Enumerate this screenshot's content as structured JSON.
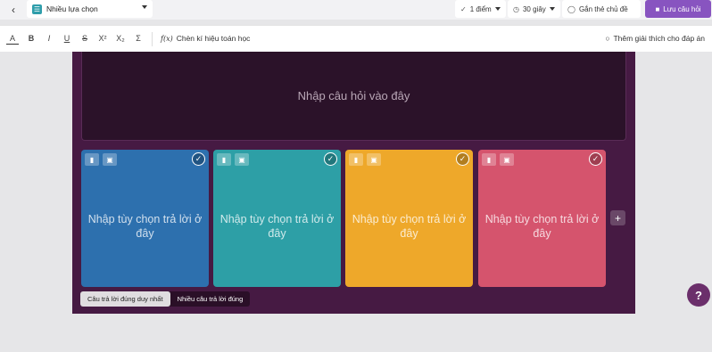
{
  "topbar": {
    "question_type": {
      "label": "Nhiều lựa chọn",
      "icon": "checklist-icon"
    },
    "points": {
      "label": "1 điểm",
      "icon": "check-icon"
    },
    "time": {
      "label": "30 giây",
      "icon": "clock-icon"
    },
    "tag": {
      "label": "Gắn thẻ chủ đề",
      "icon": "tag-icon"
    },
    "save": {
      "label": "Lưu câu hỏi",
      "icon": "save-icon"
    }
  },
  "format_toolbar": {
    "items": [
      "A",
      "B",
      "I",
      "U",
      "S",
      "X²",
      "X₂",
      "Σ"
    ],
    "math_label": "Chèn kí hiệu toán học",
    "math_icon_text": "f(x)",
    "explanation_label": "Thêm giải thích cho đáp án"
  },
  "question": {
    "placeholder": "Nhập câu hỏi vào đây"
  },
  "answers": [
    {
      "placeholder": "Nhập tùy chọn trả lời ở đây",
      "color": "#2d70ae"
    },
    {
      "placeholder": "Nhập tùy chọn trả lời ở đây",
      "color": "#2d9fa6"
    },
    {
      "placeholder": "Nhập tùy chọn trả lời ở đây",
      "color": "#eea82a"
    },
    {
      "placeholder": "Nhập tùy chọn trả lời ở đây",
      "color": "#d5546d"
    }
  ],
  "answer_mode": {
    "single": "Câu trả lời đúng duy nhất",
    "multiple": "Nhiều câu trả lời đúng"
  },
  "colors": {
    "editor_bg": "#461a43",
    "question_bg": "#2b1229",
    "accent": "#8854c0"
  }
}
